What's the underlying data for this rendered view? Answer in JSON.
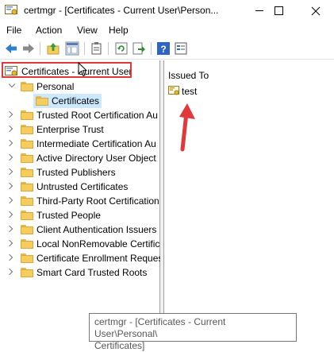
{
  "window": {
    "title": "certmgr - [Certificates - Current User\\Person...",
    "icon": "certmgr-icon"
  },
  "menu": [
    "File",
    "Action",
    "View",
    "Help"
  ],
  "toolbar": {
    "icons": [
      "back-arrow-icon",
      "forward-arrow-icon",
      "up-folder-icon",
      "show-hide-tree-icon",
      "copy-icon",
      "refresh-icon",
      "export-list-icon",
      "help-icon",
      "properties-icon"
    ]
  },
  "tree": {
    "root": "Certificates - Current User",
    "personal": "Personal",
    "personal_child": "Certificates",
    "items": [
      "Trusted Root Certification Au",
      "Enterprise Trust",
      "Intermediate Certification Au",
      "Active Directory User Object",
      "Trusted Publishers",
      "Untrusted Certificates",
      "Third-Party Root Certification",
      "Trusted People",
      "Client Authentication Issuers",
      "Local NonRemovable Certific",
      "Certificate Enrollment Reques",
      "Smart Card Trusted Roots"
    ]
  },
  "list": {
    "column_header": "Issued To",
    "rows": [
      "test"
    ]
  },
  "tooltip": {
    "line1": "certmgr - [Certificates - Current User\\Personal\\",
    "line2": "Certificates]"
  },
  "colors": {
    "highlight": "#e0393b",
    "selection": "#cce8ff",
    "folder": "#f5cd5f"
  }
}
